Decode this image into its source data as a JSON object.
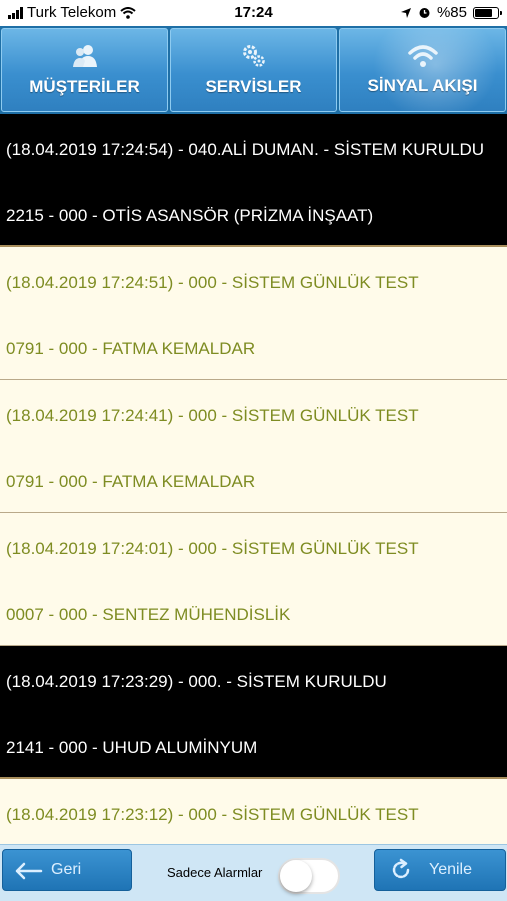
{
  "status_bar": {
    "carrier": "Turk Telekom",
    "time": "17:24",
    "battery_text": "%85",
    "battery_level": 0.85
  },
  "tabs": [
    {
      "label": "MÜŞTERİLER",
      "icon": "users-icon",
      "active": false
    },
    {
      "label": "SERVİSLER",
      "icon": "gears-icon",
      "active": false
    },
    {
      "label": "SİNYAL AKIŞI",
      "icon": "wifi-icon",
      "active": true
    }
  ],
  "signals": [
    {
      "line1": "(18.04.2019 17:24:54) - 040.ALİ DUMAN. - SİSTEM KURULDU",
      "line2": "2215 - 000 - OTİS ASANSÖR (PRİZMA İNŞAAT)",
      "style": "dark"
    },
    {
      "line1": "(18.04.2019 17:24:51) - 000 - SİSTEM GÜNLÜK TEST",
      "line2": "0791 - 000 - FATMA KEMALDAR",
      "style": "light"
    },
    {
      "line1": "(18.04.2019 17:24:41) - 000 - SİSTEM GÜNLÜK TEST",
      "line2": "0791 - 000 - FATMA KEMALDAR",
      "style": "light"
    },
    {
      "line1": "(18.04.2019 17:24:01) - 000 - SİSTEM GÜNLÜK TEST",
      "line2": "0007 - 000 - SENTEZ MÜHENDİSLİK",
      "style": "light"
    },
    {
      "line1": "(18.04.2019 17:23:29) - 000. - SİSTEM KURULDU",
      "line2": "2141 - 000 - UHUD ALUMİNYUM",
      "style": "dark"
    },
    {
      "line1": "(18.04.2019 17:23:12) - 000 - SİSTEM GÜNLÜK TEST",
      "line2": "",
      "style": "light"
    }
  ],
  "bottom_bar": {
    "back_label": "Geri",
    "toggle_label": "Sadece Alarmlar",
    "toggle_on": false,
    "refresh_label": "Yenile"
  },
  "colors": {
    "tab_blue": "#3a8fcf",
    "dark_row_bg": "#000000",
    "light_row_bg": "#fffbea",
    "light_row_text": "#7e8c22",
    "bottom_bar_bg": "#cfe6f5"
  }
}
